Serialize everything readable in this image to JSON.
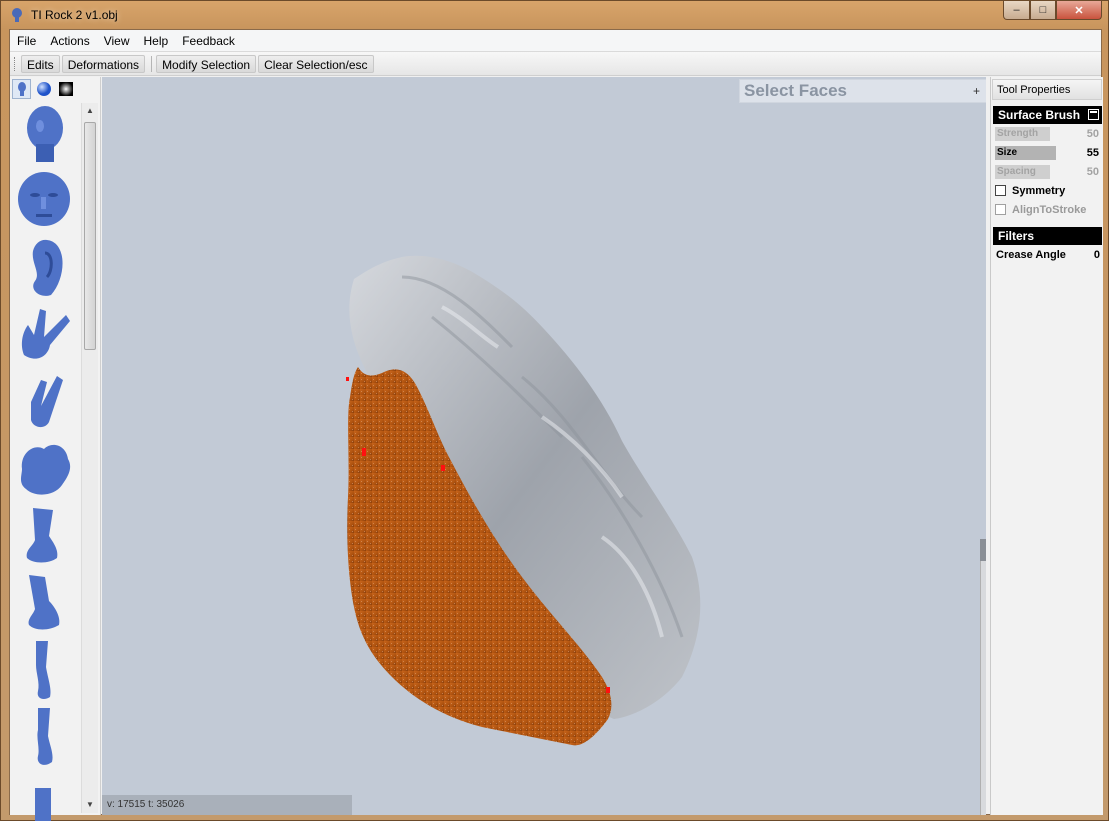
{
  "window": {
    "title": "TI Rock 2 v1.obj",
    "minimize": "–",
    "maximize": "□",
    "close": "✕"
  },
  "menu": [
    "File",
    "Actions",
    "View",
    "Help",
    "Feedback"
  ],
  "toolbar": {
    "edits": "Edits",
    "deformations": "Deformations",
    "modify_selection": "Modify Selection",
    "clear_selection": "Clear Selection/esc"
  },
  "palette": {
    "tabs": [
      "head-icon",
      "sphere-icon",
      "material-icon"
    ],
    "brushes": [
      "head",
      "face",
      "ear",
      "hand",
      "two-fingers",
      "foot-blob",
      "foot",
      "leg-foot",
      "leg",
      "boot",
      "partial"
    ]
  },
  "viewport": {
    "select_faces_title": "Select Faces",
    "select_faces_expand": "+",
    "status": "v: 17515  t: 35026"
  },
  "tool_properties": {
    "header": "Tool Properties",
    "surface_brush": {
      "title": "Surface Brush",
      "strength_label": "Strength",
      "strength_value": "50",
      "size_label": "Size",
      "size_value": "55",
      "spacing_label": "Spacing",
      "spacing_value": "50",
      "symmetry_label": "Symmetry",
      "align_label": "AlignToStroke"
    },
    "filters": {
      "title": "Filters",
      "crease_label": "Crease Angle",
      "crease_value": "0"
    }
  },
  "colors": {
    "selection": "#b85a14",
    "mesh": "#a9adb4",
    "viewport_bg": "#c2cad6",
    "brush_blue": "#4f72c7"
  }
}
